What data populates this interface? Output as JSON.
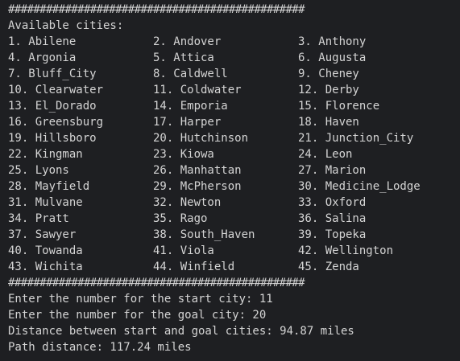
{
  "terminal": {
    "divider_top": "###############################################",
    "available_label": "Available cities:",
    "cities": [
      "1. Abilene",
      "2. Andover",
      "3. Anthony",
      "4. Argonia",
      "5. Attica",
      "6. Augusta",
      "7. Bluff_City",
      "8. Caldwell",
      "9. Cheney",
      "10. Clearwater",
      "11. Coldwater",
      "12. Derby",
      "13. El_Dorado",
      "14. Emporia",
      "15. Florence",
      "16. Greensburg",
      "17. Harper",
      "18. Haven",
      "19. Hillsboro",
      "20. Hutchinson",
      "21. Junction_City",
      "22. Kingman",
      "23. Kiowa",
      "24. Leon",
      "25. Lyons",
      "26. Manhattan",
      "27. Marion",
      "28. Mayfield",
      "29. McPherson",
      "30. Medicine_Lodge",
      "31. Mulvane",
      "32. Newton",
      "33. Oxford",
      "34. Pratt",
      "35. Rago",
      "36. Salina",
      "37. Sawyer",
      "38. South_Haven",
      "39. Topeka",
      "40. Towanda",
      "41. Viola",
      "42. Wellington",
      "43. Wichita",
      "44. Winfield",
      "45. Zenda"
    ],
    "divider_bottom": "###############################################",
    "prompt_start": "Enter the number for the start city: 11",
    "prompt_goal": "Enter the number for the goal city: 20",
    "distance_line": "Distance between start and goal cities: 94.87 miles",
    "path_line": "Path distance: 117.24 miles"
  }
}
